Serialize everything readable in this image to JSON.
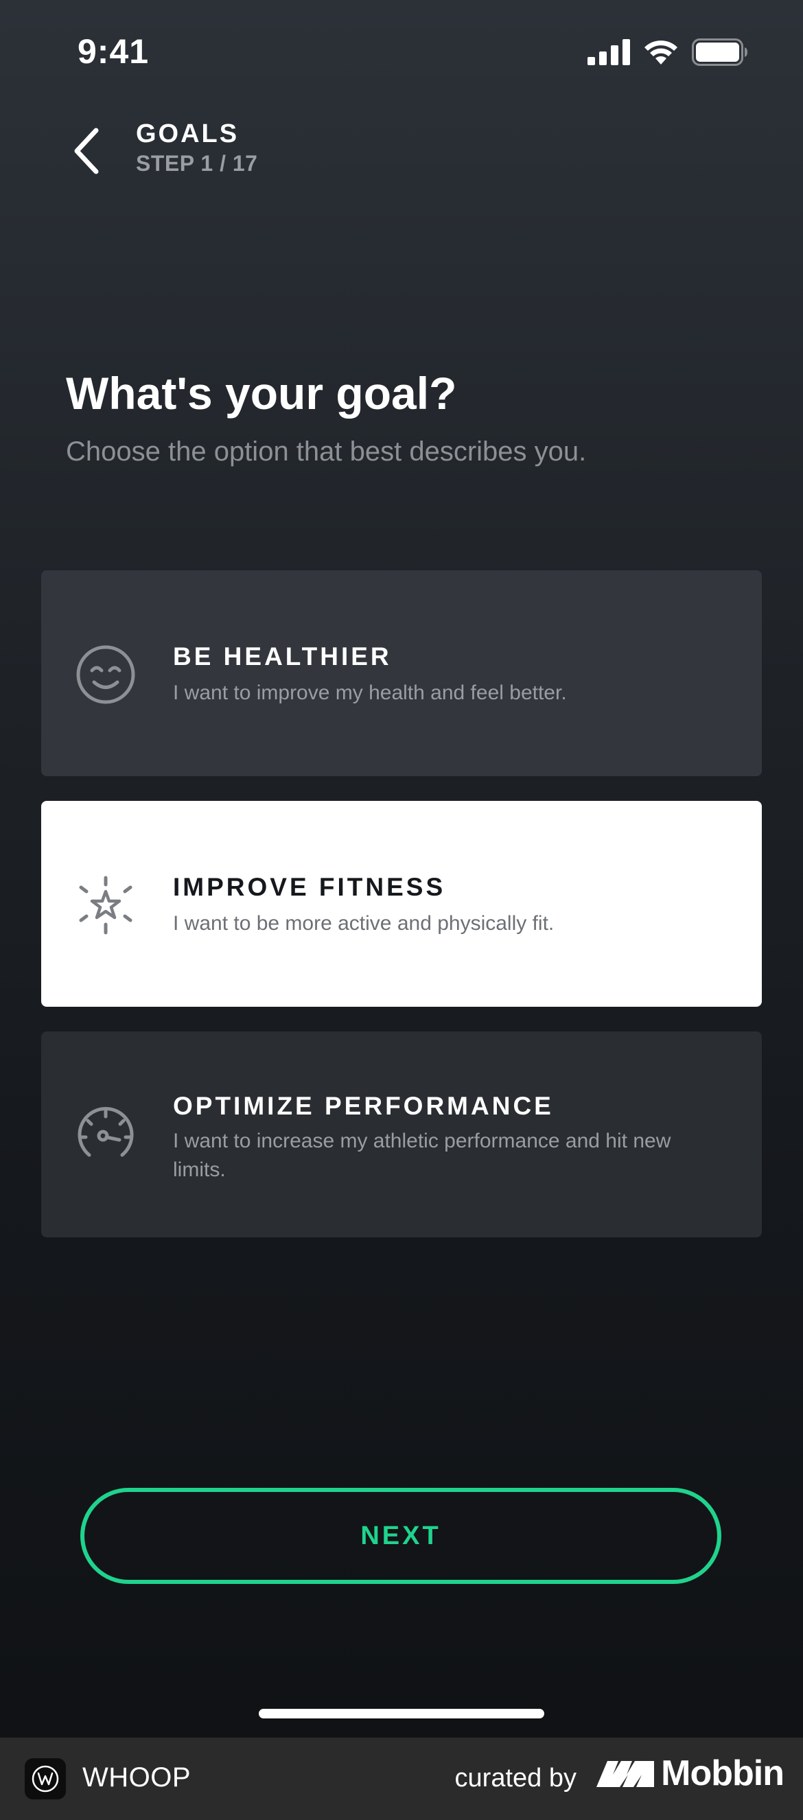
{
  "status_bar": {
    "time": "9:41"
  },
  "header": {
    "title": "GOALS",
    "step": "STEP 1 / 17"
  },
  "main": {
    "headline": "What's your goal?",
    "subhead": "Choose the option that best describes you."
  },
  "options": [
    {
      "title": "BE HEALTHIER",
      "description": "I want to improve my health and feel better.",
      "icon": "smiley-face-icon",
      "selected": false
    },
    {
      "title": "IMPROVE FITNESS",
      "description": "I want to be more active and physically fit.",
      "icon": "sparkle-star-icon",
      "selected": true
    },
    {
      "title": "OPTIMIZE PERFORMANCE",
      "description": "I want to increase my athletic performance and hit new limits.",
      "icon": "speedometer-gauge-icon",
      "selected": false
    }
  ],
  "next_button": {
    "label": "NEXT"
  },
  "footer": {
    "app_name": "WHOOP",
    "curated_label": "curated by",
    "brand": "Mobbin"
  },
  "colors": {
    "accent": "#20d38d",
    "card": "#33373d",
    "card_selected": "#ffffff"
  }
}
